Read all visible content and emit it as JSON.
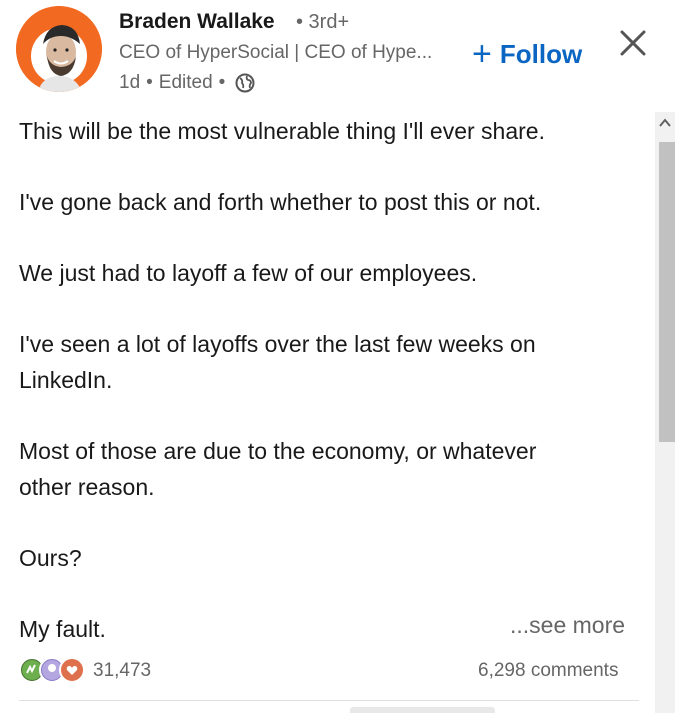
{
  "post": {
    "author": {
      "name": "Braden Wallake",
      "degree": "• 3rd+",
      "headline": "CEO of HyperSocial | CEO of Hype...",
      "time": "1d",
      "edited": "Edited",
      "visibility_icon": "globe-icon",
      "avatar_bg": "#f26a21"
    },
    "follow_label": "Follow",
    "close_icon": "close-icon",
    "paragraphs": [
      "This will be the most vulnerable thing I'll ever share.",
      "I've gone back and forth whether to post this or not.",
      "We just had to layoff a few of our employees.",
      "I've seen a lot of layoffs over the last few weeks on LinkedIn.",
      "Most of those are due to the economy, or whatever other reason.",
      "Ours?",
      "My fault."
    ],
    "see_more": "...see more",
    "reactions": {
      "count": "31,473",
      "icons": [
        "celebrate-icon",
        "support-icon",
        "love-icon"
      ]
    },
    "comments": "6,298 comments"
  },
  "colors": {
    "accent": "#0a66c2",
    "secondary_text": "#666666",
    "brand_orange": "#f26a21"
  }
}
